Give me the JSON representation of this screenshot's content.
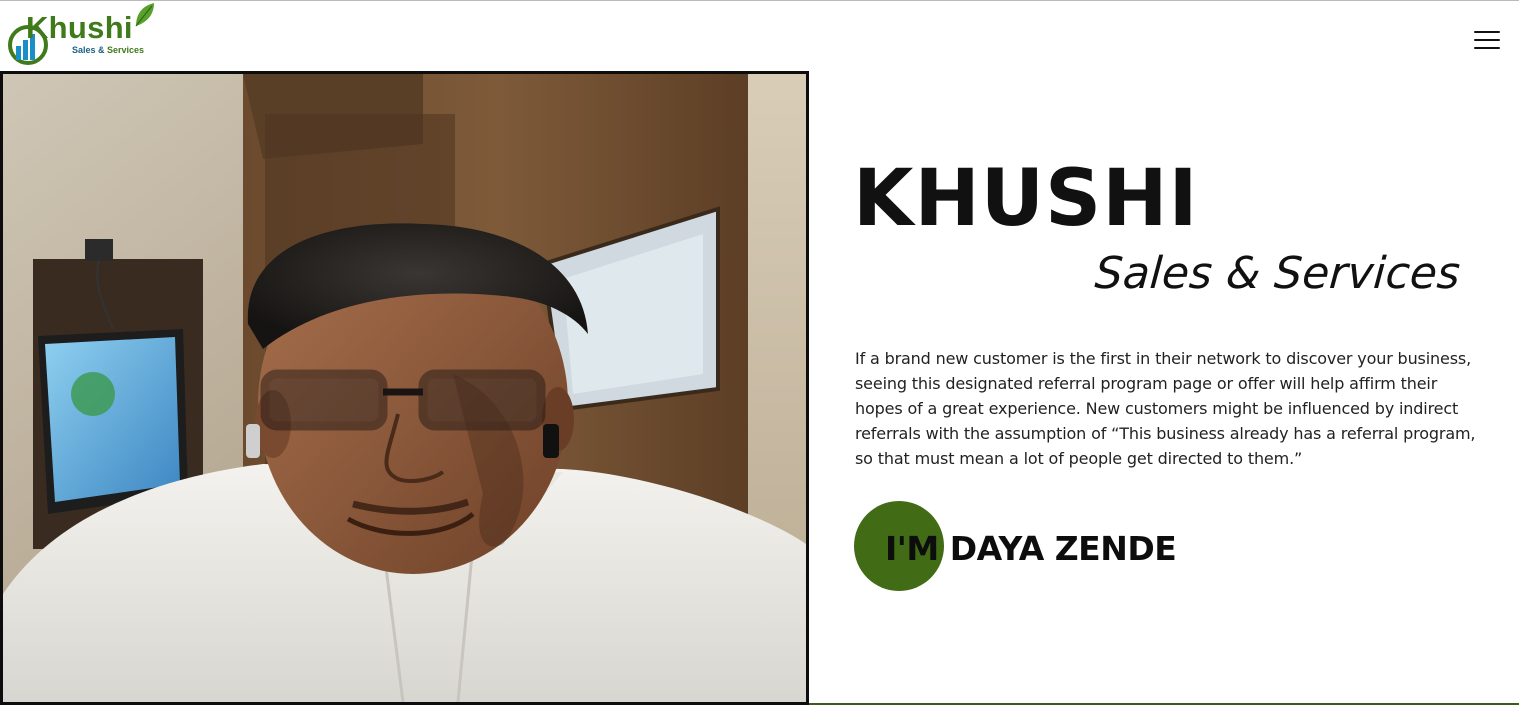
{
  "logo": {
    "word": "Khushi",
    "sub_prefix": "Sales & ",
    "sub_suffix": "Services"
  },
  "header": {
    "menu_icon": "hamburger-menu-icon"
  },
  "photo": {
    "subject": "profile-photo"
  },
  "hero": {
    "title": "KHUSHI",
    "subtitle": "Sales & Services",
    "paragraph_lines": [
      "If a brand new customer is the first in their network to discover your business,",
      "seeing this designated referral program page or offer will help affirm their",
      "hopes of a great experience. New customers might be influenced by indirect",
      "referrals with the assumption of “This business already has a referral program,",
      "so that must mean a lot of people get directed to them.”"
    ],
    "intro_name": "I'M DAYA ZENDE"
  },
  "colors": {
    "accent_green": "#416b14",
    "logo_green": "#3f7a1b",
    "logo_blue": "#1a5f86",
    "text": "#111111"
  }
}
